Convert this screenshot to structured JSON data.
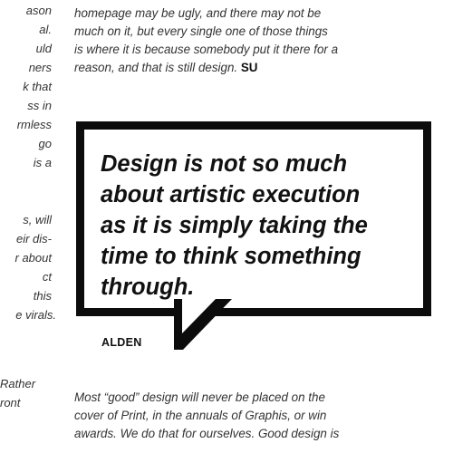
{
  "left_column_fragments": [
    "ason",
    "al.",
    "uld",
    "ners",
    "k that",
    "ss in",
    "rmless",
    "go",
    "is a",
    "s, will",
    "eir dis-",
    "r about",
    "ct",
    "this",
    "e virals.",
    "Rather",
    "ront"
  ],
  "top_paragraph": {
    "lines": [
      "homepage may be ugly, and there may not be",
      "much on it, but every single one of those things",
      "is where it is because somebody put it there for a",
      "reason, and that is still design."
    ],
    "initials": "SU"
  },
  "pull_quote": {
    "lines": [
      "Design is not so much",
      "about artistic execution",
      "as it is simply taking the",
      "time to think something",
      "through."
    ],
    "author": "ALDEN"
  },
  "bottom_paragraph": {
    "lines": [
      "Most “good” design will never be placed on the",
      "cover of Print, in the annuals of Graphis, or win",
      "awards. We do that for ourselves. Good design is"
    ]
  },
  "colors": {
    "quote_border": "#0c0c0c",
    "body_text": "#333333",
    "background": "#ffffff"
  }
}
